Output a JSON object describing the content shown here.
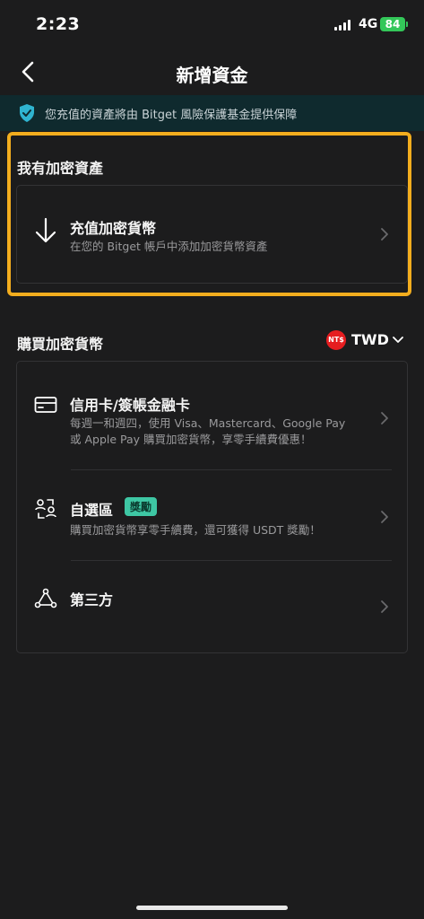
{
  "status_bar": {
    "time": "2:23",
    "network": "4G",
    "battery": "84"
  },
  "header": {
    "title": "新增資金"
  },
  "banner": {
    "text": "您充值的資產將由 Bitget 風險保護基金提供保障"
  },
  "section_have": {
    "title": "我有加密資產",
    "item": {
      "title": "充值加密貨幣",
      "subtitle": "在您的 Bitget 帳戶中添加加密貨幣資產"
    }
  },
  "section_buy": {
    "title": "購買加密貨幣",
    "currency_icon_text": "NT$",
    "currency": "TWD",
    "items": [
      {
        "title": "信用卡/簽帳金融卡",
        "subtitle_line1": "每週一和週四，使用 Visa、Mastercard、Google Pay",
        "subtitle_line2": "或 Apple Pay 購買加密貨幣，享零手續費優惠！"
      },
      {
        "title": "自選區",
        "badge": "獎勵",
        "subtitle": "購買加密貨幣享零手續費，還可獲得 USDT 獎勵！"
      },
      {
        "title": "第三方"
      }
    ]
  },
  "colors": {
    "highlight": "#f3ad1e",
    "accent": "#3ec7a4",
    "background": "#1c1c1d"
  }
}
